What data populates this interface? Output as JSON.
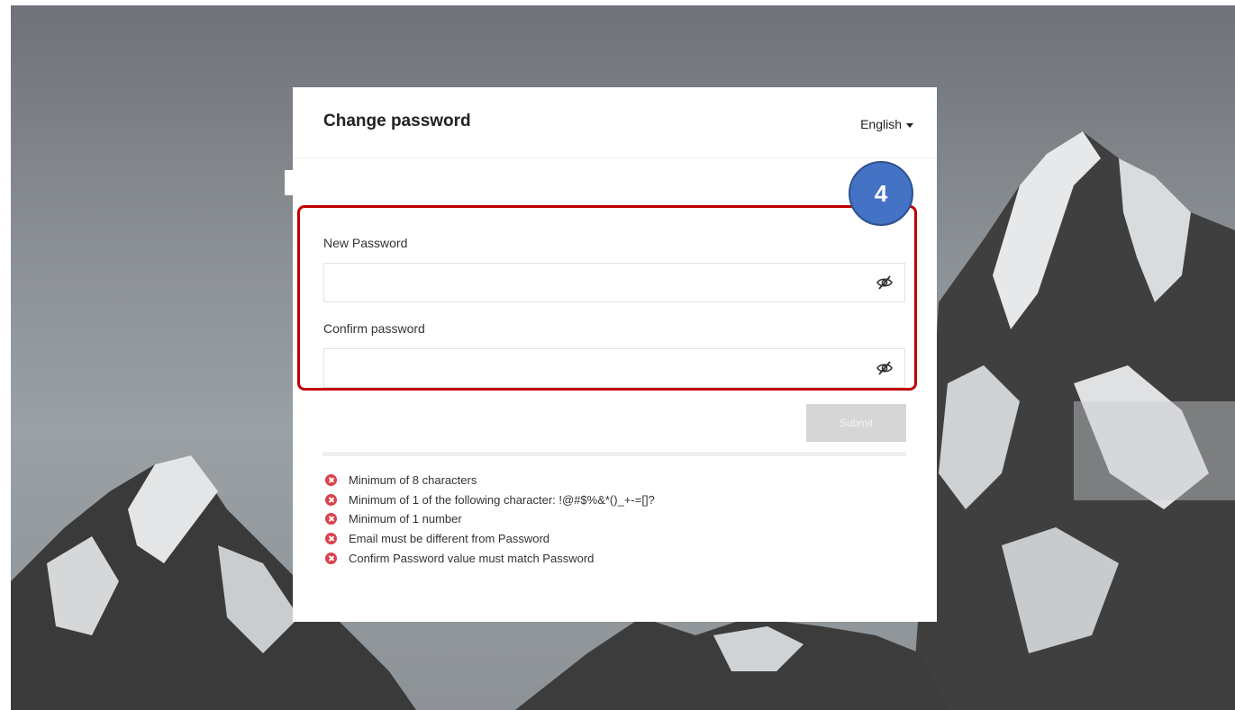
{
  "header": {
    "title": "Change password",
    "language": "English"
  },
  "form": {
    "new_password_label": "New Password",
    "new_password_value": "",
    "confirm_password_label": "Confirm password",
    "confirm_password_value": "",
    "submit_label": "Submit"
  },
  "requirements": [
    {
      "text": "Minimum of 8 characters",
      "status": "unmet"
    },
    {
      "text": "Minimum of 1 of the following character: !@#$%&*()_+-=[]?",
      "status": "unmet"
    },
    {
      "text": "Minimum of 1 number",
      "status": "unmet"
    },
    {
      "text": "Email must be different from Password",
      "status": "unmet"
    },
    {
      "text": "Confirm Password value must match Password",
      "status": "unmet"
    }
  ],
  "annotation": {
    "step_number": "4",
    "highlight_color": "#c00000",
    "badge_color": "#4472c4"
  },
  "icons": {
    "password_toggle": "eye-slash-icon",
    "requirement_status": "x-circle-icon",
    "language_dropdown": "caret-down-icon"
  },
  "colors": {
    "error": "#d9434c",
    "submit_disabled": "#d6d6d6"
  }
}
